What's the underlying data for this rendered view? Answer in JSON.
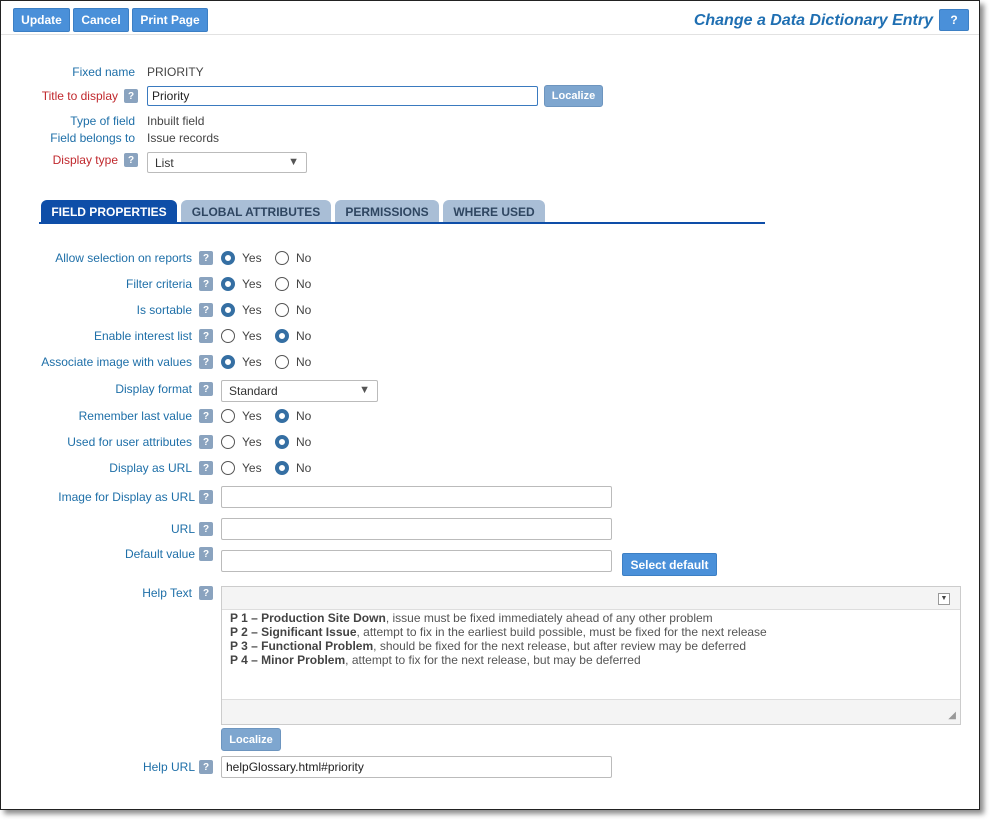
{
  "toolbar": {
    "update": "Update",
    "cancel": "Cancel",
    "print": "Print Page"
  },
  "page_title": "Change a Data Dictionary Entry",
  "help_button": "?",
  "header_fields": {
    "fixed_name_label": "Fixed name",
    "fixed_name_value": "PRIORITY",
    "title_label": "Title to display",
    "title_value": "Priority",
    "localize": "Localize",
    "type_label": "Type of field",
    "type_value": "Inbuilt field",
    "belongs_label": "Field belongs to",
    "belongs_value": "Issue records",
    "display_type_label": "Display type",
    "display_type_value": "List"
  },
  "tabs": [
    "FIELD PROPERTIES",
    "GLOBAL ATTRIBUTES",
    "PERMISSIONS",
    "WHERE USED"
  ],
  "properties": [
    {
      "label": "Allow selection on reports",
      "value": "Yes"
    },
    {
      "label": "Filter criteria",
      "value": "Yes"
    },
    {
      "label": "Is sortable",
      "value": "Yes"
    },
    {
      "label": "Enable interest list",
      "value": "No"
    },
    {
      "label": "Associate image with values",
      "value": "Yes"
    },
    {
      "label": "Display format",
      "value": "Standard"
    },
    {
      "label": "Remember last value",
      "value": "No"
    },
    {
      "label": "Used for user attributes",
      "value": "No"
    },
    {
      "label": "Display as URL",
      "value": "No"
    }
  ],
  "radio_labels": {
    "yes": "Yes",
    "no": "No"
  },
  "image_url_label": "Image for Display as URL",
  "url_label": "URL",
  "default_value_label": "Default value",
  "select_default": "Select default",
  "help_text_label": "Help Text",
  "help_text": [
    {
      "key": "P 1 – Production Site Down",
      "desc": ", issue must be fixed immediately ahead of any other problem"
    },
    {
      "key": "P 2 – Significant Issue",
      "desc": ", attempt to fix in the earliest build possible, must be fixed for the next release"
    },
    {
      "key": "P 3 – Functional Problem",
      "desc": ", should be fixed for the next release, but after review may be deferred"
    },
    {
      "key": "P 4 – Minor Problem",
      "desc": ", attempt to fix for the next release, but may be deferred"
    }
  ],
  "localize2": "Localize",
  "help_url_label": "Help URL",
  "help_url_value": "helpGlossary.html#priority"
}
